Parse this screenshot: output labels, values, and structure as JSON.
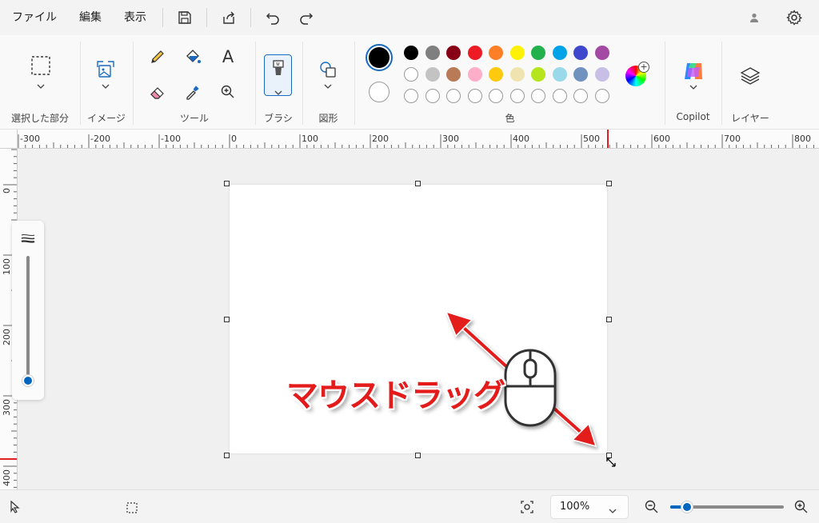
{
  "menu": {
    "file": "ファイル",
    "edit": "編集",
    "view": "表示"
  },
  "ribbon": {
    "selection_label": "選択した部分",
    "image_label": "イメージ",
    "tools_label": "ツール",
    "brush_label": "ブラシ",
    "shapes_label": "図形",
    "color_label": "色",
    "copilot_label": "Copilot",
    "layers_label": "レイヤー",
    "text_tool_glyph": "A",
    "primary_color": "#000000",
    "secondary_color": "#ffffff",
    "palette_row1": [
      "#000000",
      "#7f7f7f",
      "#880015",
      "#ed1c24",
      "#ff7f27",
      "#fff200",
      "#22b14c",
      "#00a2e8",
      "#3f48cc",
      "#a349a4"
    ],
    "palette_row2": [
      "#ffffff",
      "#c3c3c3",
      "#b97a57",
      "#ffaec9",
      "#ffc90e",
      "#efe4b0",
      "#b5e61d",
      "#99d9ea",
      "#7092be",
      "#c8bfe7"
    ]
  },
  "rulers": {
    "horizontal": [
      "-300",
      "-200",
      "-100",
      "0",
      "100",
      "200",
      "300",
      "400",
      "500",
      "600",
      "700",
      "800"
    ],
    "vertical": [
      "0",
      "100",
      "200",
      "300",
      "400"
    ]
  },
  "annotation": {
    "text": "マウスドラッグ",
    "color": "#e31b1b"
  },
  "status": {
    "zoom": "100%"
  },
  "accent": "#0067c0"
}
